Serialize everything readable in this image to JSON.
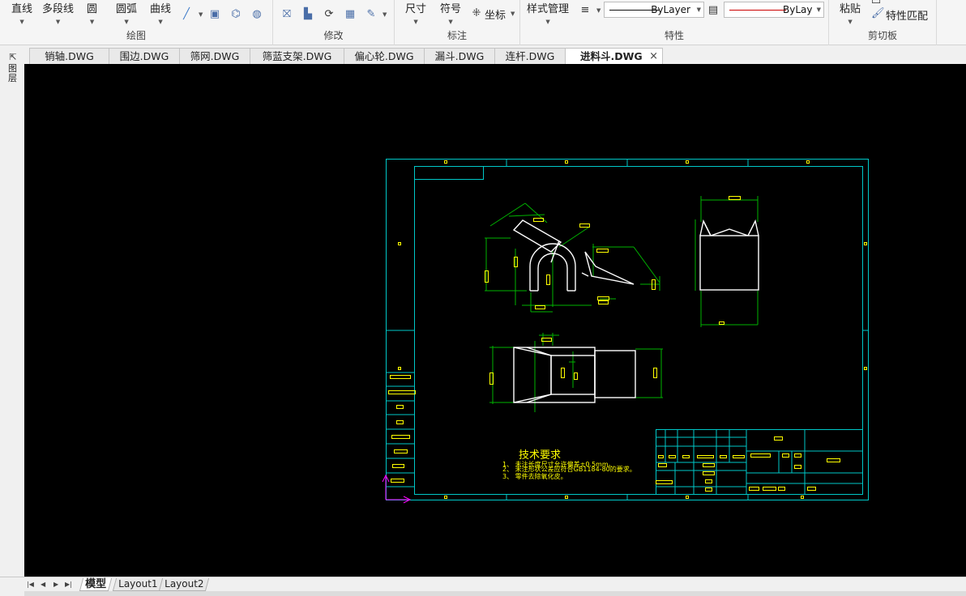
{
  "ribbon": {
    "draw": {
      "label": "绘图",
      "buttons": [
        "直线",
        "多段线",
        "圆",
        "圆弧",
        "曲线"
      ]
    },
    "modify": {
      "label": "修改"
    },
    "annotate": {
      "label": "标注",
      "buttons": [
        "尺寸",
        "符号"
      ],
      "coord_label": "坐标"
    },
    "properties": {
      "label": "特性",
      "style_manager": "样式管理",
      "linetype": "ByLayer",
      "lineweight": "ByLayer"
    },
    "clipboard": {
      "label": "剪切板",
      "paste": "粘贴",
      "match_properties": "特性匹配"
    }
  },
  "tabs": [
    {
      "label": "销轴.DWG"
    },
    {
      "label": "围边.DWG"
    },
    {
      "label": "筛网.DWG"
    },
    {
      "label": "筛蓝支架.DWG"
    },
    {
      "label": "偏心轮.DWG"
    },
    {
      "label": "漏斗.DWG"
    },
    {
      "label": "连杆.DWG"
    },
    {
      "label": "进料斗.DWG",
      "active": true
    }
  ],
  "side_panel": {
    "label": "图层"
  },
  "drawing": {
    "tech_title": "技术要求",
    "notes": [
      "1、 未注长度尺寸允许偏差±0.5mm。",
      "2、 未注形状公差应符合GB1184-80的要求。",
      "3、 零件去除氧化皮。"
    ],
    "colors": {
      "frame": "#00c8c8",
      "geometry": "#ffffff",
      "dimension": "#00b400",
      "text": "#ffff00",
      "ucs": "#ff00ff",
      "background": "#000000"
    }
  },
  "layouts": [
    {
      "label": "模型",
      "active": true
    },
    {
      "label": "Layout1"
    },
    {
      "label": "Layout2"
    }
  ]
}
